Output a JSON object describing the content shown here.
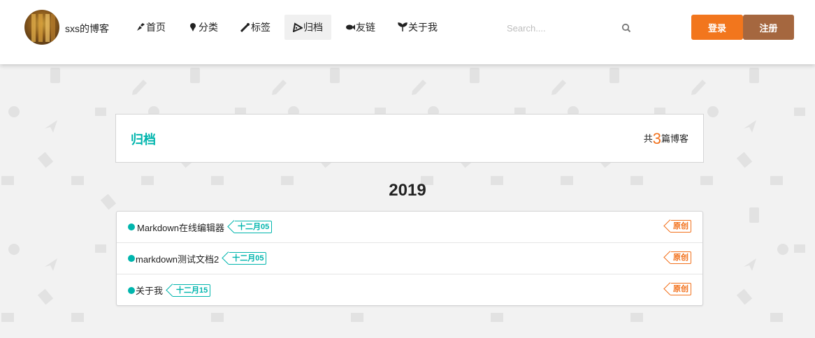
{
  "header": {
    "site_name": "sxs的博客",
    "nav": [
      {
        "label": "首页",
        "icon": "home-icon"
      },
      {
        "label": "分类",
        "icon": "category-icon"
      },
      {
        "label": "标签",
        "icon": "tag-icon"
      },
      {
        "label": "归档",
        "icon": "archive-icon",
        "active": true
      },
      {
        "label": "友链",
        "icon": "fish-icon"
      },
      {
        "label": "关于我",
        "icon": "leaf-icon"
      }
    ],
    "search_placeholder": "Search....",
    "login_label": "登录",
    "register_label": "注册"
  },
  "colors": {
    "accent_teal": "#00b5ad",
    "accent_orange": "#f2711c",
    "login_bg": "#f2761d",
    "register_bg": "#a5673f"
  },
  "archive": {
    "title": "归档",
    "count_prefix": "共",
    "count": "3",
    "count_suffix": "篇博客",
    "year": "2019",
    "posts": [
      {
        "title": "Markdown在线编辑器",
        "date": "十二月05",
        "flag": "原创"
      },
      {
        "title": "markdown测试文档2",
        "date": "十二月05",
        "flag": "原创"
      },
      {
        "title": "关于我",
        "date": "十二月15",
        "flag": "原创"
      }
    ]
  }
}
